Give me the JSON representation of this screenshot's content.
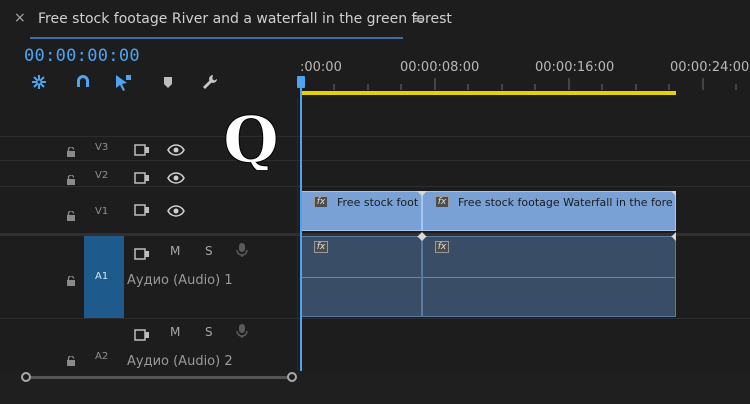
{
  "panel": {
    "close_glyph": "×",
    "title": "Free stock footage River and a waterfall in the green forest",
    "menu_glyph": "≡"
  },
  "timecode": "00:00:00:00",
  "toolbar": {
    "icons": [
      "snap-icon",
      "magnet-icon",
      "linked-selection-icon",
      "marker-icon",
      "wrench-icon"
    ]
  },
  "ruler": {
    "labels": [
      ":00:00",
      "00:00:08:00",
      "00:00:16:00",
      "00:00:24:00"
    ]
  },
  "overlay": {
    "letter": "Q"
  },
  "tracks": {
    "video": [
      {
        "name": "V3"
      },
      {
        "name": "V2"
      },
      {
        "name": "V1"
      }
    ],
    "audio": [
      {
        "name": "A1",
        "mute": "M",
        "solo": "S",
        "label": "Аудио (Audio) 1"
      },
      {
        "name": "A2",
        "mute": "M",
        "solo": "S",
        "label": "Аудио (Audio) 2"
      }
    ]
  },
  "clips": {
    "v1": [
      {
        "fx": "fx",
        "title": "Free stock foota"
      },
      {
        "fx": "fx",
        "title": "Free stock footage Waterfall in the forest"
      }
    ],
    "a1": [
      {
        "fx": "fx"
      },
      {
        "fx": "fx"
      }
    ]
  },
  "colors": {
    "accent": "#4ea3f2",
    "workarea": "#e7d200",
    "video_clip": "#7aa1d6",
    "audio_clip": "#394d66",
    "target_track": "#1f5a8c"
  }
}
